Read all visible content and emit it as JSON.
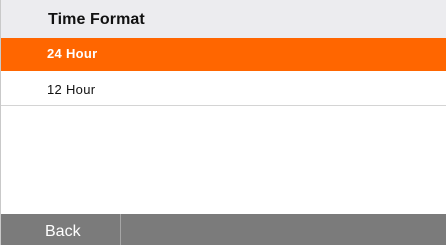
{
  "header": {
    "title": "Time Format"
  },
  "options": [
    {
      "label": "24 Hour",
      "selected": true
    },
    {
      "label": "12 Hour",
      "selected": false
    }
  ],
  "footer": {
    "back_label": "Back"
  },
  "colors": {
    "accent": "#ff6600",
    "header_bg": "#ececef",
    "footer_bg": "#7b7b7b"
  }
}
